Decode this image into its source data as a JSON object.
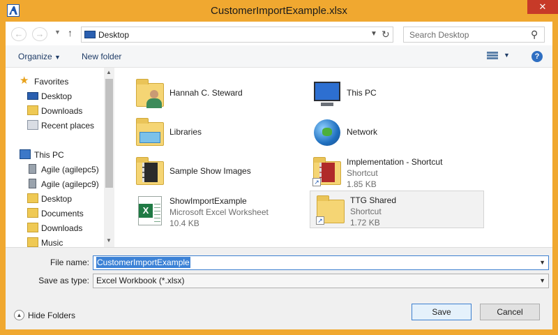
{
  "window": {
    "title": "CustomerImportExample.xlsx",
    "close_glyph": "✕"
  },
  "address_bar": {
    "location": "Desktop",
    "search_placeholder": "Search Desktop"
  },
  "toolbar": {
    "organize_label": "Organize",
    "new_folder_label": "New folder",
    "help_glyph": "?"
  },
  "nav_pane": {
    "items": [
      {
        "label": "Favorites",
        "icon": "star-icon"
      },
      {
        "label": "Desktop",
        "icon": "desktop-icon"
      },
      {
        "label": "Downloads",
        "icon": "downloads-folder-icon"
      },
      {
        "label": "Recent places",
        "icon": "recent-places-icon"
      },
      {
        "label": "This PC",
        "icon": "computer-icon"
      },
      {
        "label": "Agile (agilepc5)",
        "icon": "network-drive-icon"
      },
      {
        "label": "Agile (agilepc9)",
        "icon": "network-drive-icon"
      },
      {
        "label": "Desktop",
        "icon": "desktop-folder-icon"
      },
      {
        "label": "Documents",
        "icon": "documents-folder-icon"
      },
      {
        "label": "Downloads",
        "icon": "downloads-folder-icon"
      },
      {
        "label": "Music",
        "icon": "music-folder-icon"
      }
    ]
  },
  "content": {
    "items": [
      {
        "name": "Hannah C. Steward",
        "line2": "",
        "line3": "",
        "icon": "user-folder-icon"
      },
      {
        "name": "This PC",
        "line2": "",
        "line3": "",
        "icon": "computer-icon"
      },
      {
        "name": "Libraries",
        "line2": "",
        "line3": "",
        "icon": "libraries-folder-icon"
      },
      {
        "name": "Network",
        "line2": "",
        "line3": "",
        "icon": "network-globe-icon"
      },
      {
        "name": "Sample Show Images",
        "line2": "",
        "line3": "",
        "icon": "folder-icon"
      },
      {
        "name": "Implementation - Shortcut",
        "line2": "Shortcut",
        "line3": "1.85 KB",
        "icon": "folder-shortcut-icon"
      },
      {
        "name": "ShowImportExample",
        "line2": "Microsoft Excel Worksheet",
        "line3": "10.4 KB",
        "icon": "excel-file-icon"
      },
      {
        "name": "TTG Shared",
        "line2": "Shortcut",
        "line3": "1.72 KB",
        "icon": "folder-shortcut-icon"
      }
    ]
  },
  "form": {
    "file_name_label": "File name:",
    "file_name_value": "CustomerImportExample",
    "save_type_label": "Save as type:",
    "save_type_value": "Excel Workbook (*.xlsx)",
    "hide_folders_label": "Hide Folders",
    "save_label": "Save",
    "cancel_label": "Cancel"
  },
  "colors": {
    "frame": "#f0a830",
    "close": "#c73a28",
    "accent": "#3c82d6"
  }
}
